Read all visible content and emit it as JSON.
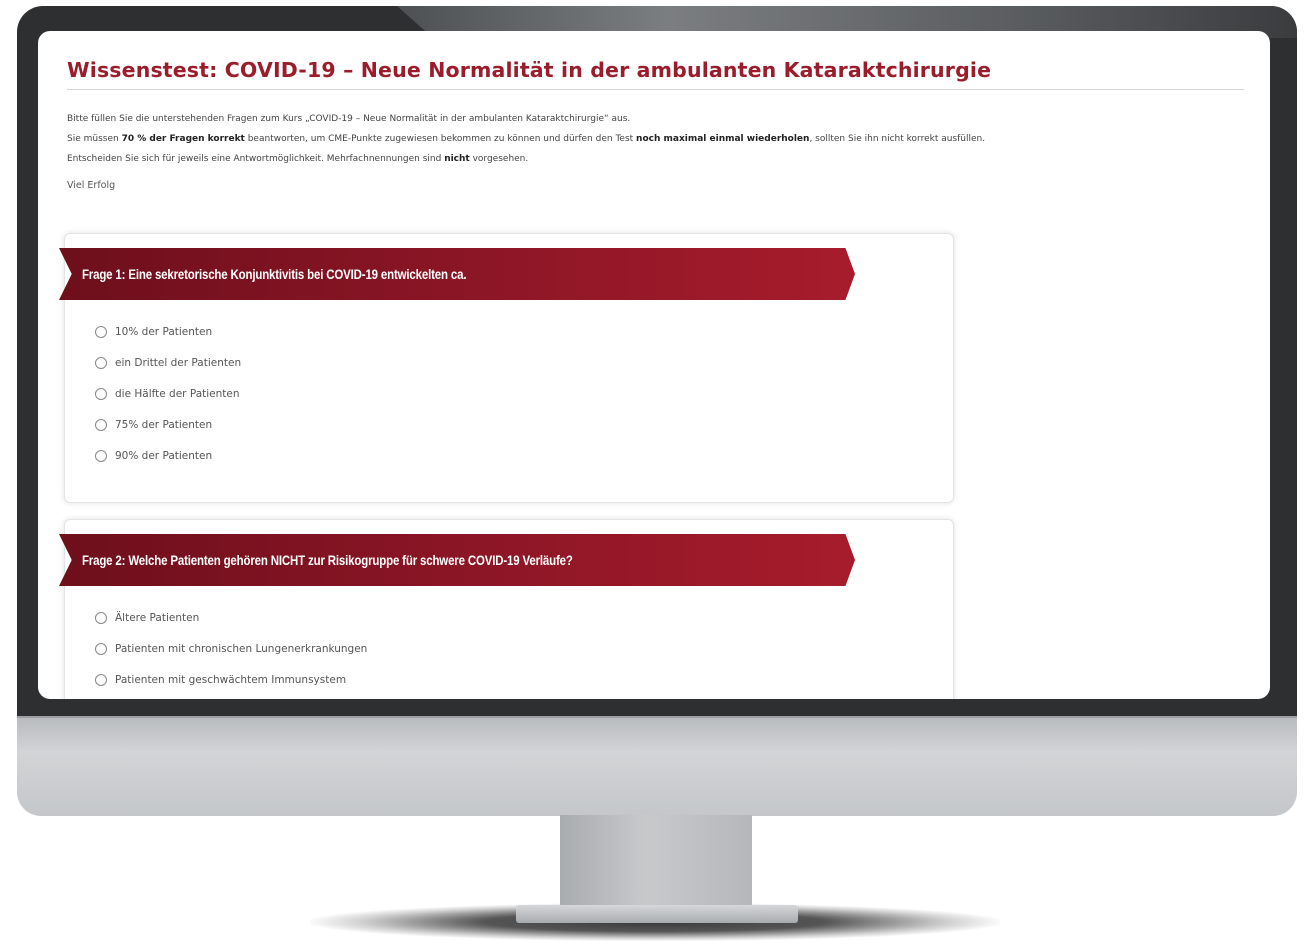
{
  "quiz": {
    "title": "Wissenstest: COVID-19 – Neue Normalität in der ambulanten Kataraktchirurgie",
    "intro_line1": "Bitte füllen Sie die unterstehenden Fragen zum Kurs „COVID-19 – Neue Normalität in der ambulanten Kataraktchirurgie“ aus.",
    "intro_line2_a": "Sie müssen ",
    "intro_line2_b": "70 % der Fragen korrekt",
    "intro_line2_c": " beantworten, um CME-Punkte zugewiesen bekommen zu können und dürfen den Test ",
    "intro_line2_d": "noch maximal einmal wiederholen",
    "intro_line2_e": ", sollten Sie ihn nicht korrekt ausfüllen.",
    "intro_line3_a": "Entscheiden Sie sich für jeweils eine Antwortmöglichkeit. Mehrfachnennungen sind ",
    "intro_line3_b": "nicht",
    "intro_line3_c": " vorgesehen.",
    "good_luck": "Viel Erfolg",
    "questions": [
      {
        "label": "Frage 1: Eine sekretorische Konjunktivitis bei COVID-19 entwickelten ca.",
        "options": [
          "10% der Patienten",
          "ein Drittel der Patienten",
          "die Hälfte der Patienten",
          "75% der Patienten",
          "90% der Patienten"
        ]
      },
      {
        "label": "Frage 2: Welche Patienten gehören NICHT zur Risikogruppe für schwere COVID-19 Verläufe?",
        "options": [
          "Ältere Patienten",
          "Patienten mit chronischen Lungenerkrankungen",
          "Patienten mit geschwächtem Immunsystem"
        ]
      }
    ]
  },
  "colors": {
    "accent": "#9b1c2a",
    "banner_dark": "#6e0f1c",
    "banner_light": "#a71c2c",
    "monitor_frame": "#2d2f31",
    "monitor_chin": "#c4c7c9"
  }
}
